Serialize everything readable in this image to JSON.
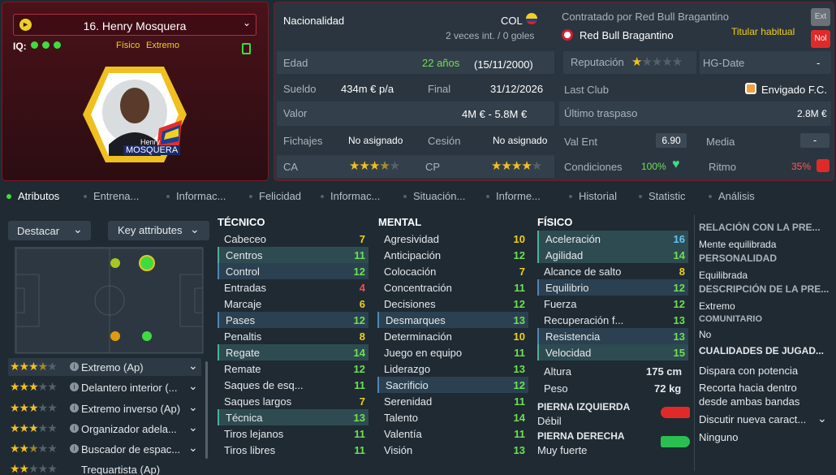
{
  "player": {
    "name": "16. Henry Mosquera",
    "iq_label": "IQ:",
    "tags": [
      "Físico",
      "Extremo"
    ],
    "badge_first": "Henry",
    "badge_last": "MOSQUERA"
  },
  "info": {
    "nationality_label": "Nacionalidad",
    "nationality_value": "COL",
    "caps": "2 veces int. / 0 goles",
    "contract_label": "Contratado por Red Bull Bragantino",
    "club": "Red Bull Bragantino",
    "squad_status": "Titular habitual",
    "ext_btn": "Ext",
    "nol_btn": "Nol",
    "age_label": "Edad",
    "age_value": "22 años",
    "dob": "(15/11/2000)",
    "reputation_label": "Reputación",
    "reputation_stars": 1,
    "hgdate_label": "HG-Date",
    "hgdate_value": "-",
    "salary_label": "Sueldo",
    "salary_value": "434m € p/a",
    "end_label": "Final",
    "end_value": "31/12/2026",
    "lastclub_label": "Last Club",
    "lastclub_value": "Envigado F.C.",
    "value_label": "Valor",
    "value_value": "4M € - 5.8M €",
    "lasttransfer_label": "Último traspaso",
    "lasttransfer_value": "2.8M €",
    "signings_label": "Fichajes",
    "signings_value": "No asignado",
    "loan_label": "Cesión",
    "loan_value": "No asignado",
    "valent_label": "Val Ent",
    "valent_value": "6.90",
    "media_label": "Media",
    "media_value": "-",
    "ca_label": "CA",
    "ca_stars": 3.5,
    "cp_label": "CP",
    "cp_stars": 4,
    "conditions_label": "Condiciones",
    "conditions_value": "100%",
    "rhythm_label": "Ritmo",
    "rhythm_value": "35%"
  },
  "tabs": [
    "Atributos",
    "Entrena...",
    "Informac...",
    "Felicidad",
    "Informac...",
    "Situación...",
    "Informe...",
    "Historial",
    "Statistic",
    "Análisis"
  ],
  "left_panel": {
    "highlight_btn": "Destacar",
    "key_attr_btn": "Key attributes",
    "roles": [
      {
        "name": "Extremo (Ap)",
        "stars": 3.5
      },
      {
        "name": "Delantero interior (...",
        "stars": 3
      },
      {
        "name": "Extremo inverso (Ap)",
        "stars": 3
      },
      {
        "name": "Organizador adela...",
        "stars": 3
      },
      {
        "name": "Buscador de espac...",
        "stars": 2.5
      },
      {
        "name": "Trequartista (Ap)",
        "stars": 2
      }
    ]
  },
  "technical": {
    "title": "TÉCNICO",
    "rows": [
      {
        "name": "Cabeceo",
        "value": "7",
        "color": "#f0d020",
        "hl": ""
      },
      {
        "name": "Centros",
        "value": "11",
        "color": "#6ee052",
        "hl": "hl"
      },
      {
        "name": "Control",
        "value": "12",
        "color": "#6ee052",
        "hl": "hlb"
      },
      {
        "name": "Entradas",
        "value": "4",
        "color": "#ff4a4a",
        "hl": ""
      },
      {
        "name": "Marcaje",
        "value": "6",
        "color": "#f0d020",
        "hl": ""
      },
      {
        "name": "Pases",
        "value": "12",
        "color": "#6ee052",
        "hl": "hlb"
      },
      {
        "name": "Penaltis",
        "value": "8",
        "color": "#f0d020",
        "hl": ""
      },
      {
        "name": "Regate",
        "value": "14",
        "color": "#6ee052",
        "hl": "hl"
      },
      {
        "name": "Remate",
        "value": "12",
        "color": "#6ee052",
        "hl": ""
      },
      {
        "name": "Saques de esq...",
        "value": "11",
        "color": "#6ee052",
        "hl": ""
      },
      {
        "name": "Saques largos",
        "value": "7",
        "color": "#f0d020",
        "hl": ""
      },
      {
        "name": "Técnica",
        "value": "13",
        "color": "#6ee052",
        "hl": "hl"
      },
      {
        "name": "Tiros lejanos",
        "value": "11",
        "color": "#6ee052",
        "hl": ""
      },
      {
        "name": "Tiros libres",
        "value": "11",
        "color": "#6ee052",
        "hl": ""
      }
    ]
  },
  "mental": {
    "title": "MENTAL",
    "rows": [
      {
        "name": "Agresividad",
        "value": "10",
        "color": "#f0d020",
        "hl": ""
      },
      {
        "name": "Anticipación",
        "value": "12",
        "color": "#6ee052",
        "hl": ""
      },
      {
        "name": "Colocación",
        "value": "7",
        "color": "#f0d020",
        "hl": ""
      },
      {
        "name": "Concentración",
        "value": "11",
        "color": "#6ee052",
        "hl": ""
      },
      {
        "name": "Decisiones",
        "value": "12",
        "color": "#6ee052",
        "hl": ""
      },
      {
        "name": "Desmarques",
        "value": "13",
        "color": "#6ee052",
        "hl": "hlb"
      },
      {
        "name": "Determinación",
        "value": "10",
        "color": "#f0d020",
        "hl": ""
      },
      {
        "name": "Juego en equipo",
        "value": "11",
        "color": "#6ee052",
        "hl": ""
      },
      {
        "name": "Liderazgo",
        "value": "13",
        "color": "#6ee052",
        "hl": ""
      },
      {
        "name": "Sacrificio",
        "value": "12",
        "color": "#6ee052",
        "hl": "hlb"
      },
      {
        "name": "Serenidad",
        "value": "11",
        "color": "#6ee052",
        "hl": ""
      },
      {
        "name": "Talento",
        "value": "14",
        "color": "#6ee052",
        "hl": ""
      },
      {
        "name": "Valentía",
        "value": "11",
        "color": "#6ee052",
        "hl": ""
      },
      {
        "name": "Visión",
        "value": "13",
        "color": "#6ee052",
        "hl": ""
      }
    ]
  },
  "physical": {
    "title": "FÍSICO",
    "rows": [
      {
        "name": "Aceleración",
        "value": "16",
        "color": "#5fc8f0",
        "hl": "hl"
      },
      {
        "name": "Agilidad",
        "value": "14",
        "color": "#6ee052",
        "hl": "hl"
      },
      {
        "name": "Alcance de salto",
        "value": "8",
        "color": "#f0d020",
        "hl": ""
      },
      {
        "name": "Equilibrio",
        "value": "12",
        "color": "#6ee052",
        "hl": "hlb"
      },
      {
        "name": "Fuerza",
        "value": "12",
        "color": "#6ee052",
        "hl": ""
      },
      {
        "name": "Recuperación f...",
        "value": "13",
        "color": "#6ee052",
        "hl": ""
      },
      {
        "name": "Resistencia",
        "value": "13",
        "color": "#6ee052",
        "hl": "hlb"
      },
      {
        "name": "Velocidad",
        "value": "15",
        "color": "#6ee052",
        "hl": "hl"
      }
    ],
    "height_label": "Altura",
    "height_value": "175 cm",
    "weight_label": "Peso",
    "weight_value": "72 kg",
    "left_foot_label": "PIERNA IZQUIERDA",
    "left_foot_value": "Débil",
    "right_foot_label": "PIERNA DERECHA",
    "right_foot_value": "Muy fuerte"
  },
  "right_col": {
    "rel_title": "RELACIÓN CON LA PRE...",
    "rel_value": "Mente equilibrada",
    "pers_title": "PERSONALIDAD",
    "pers_value": "Equilibrada",
    "desc_title": "DESCRIPCIÓN DE LA PRE...",
    "desc_value": "Extremo",
    "comm_title": "COMUNITARIO",
    "comm_value": "No",
    "qual_title": "CUALIDADES DE JUGAD...",
    "qual_items": [
      "Dispara con potencia",
      "Recorta hacia dentro desde ambas bandas"
    ],
    "discuss": "Discutir nueva caract...",
    "none": "Ninguno"
  }
}
